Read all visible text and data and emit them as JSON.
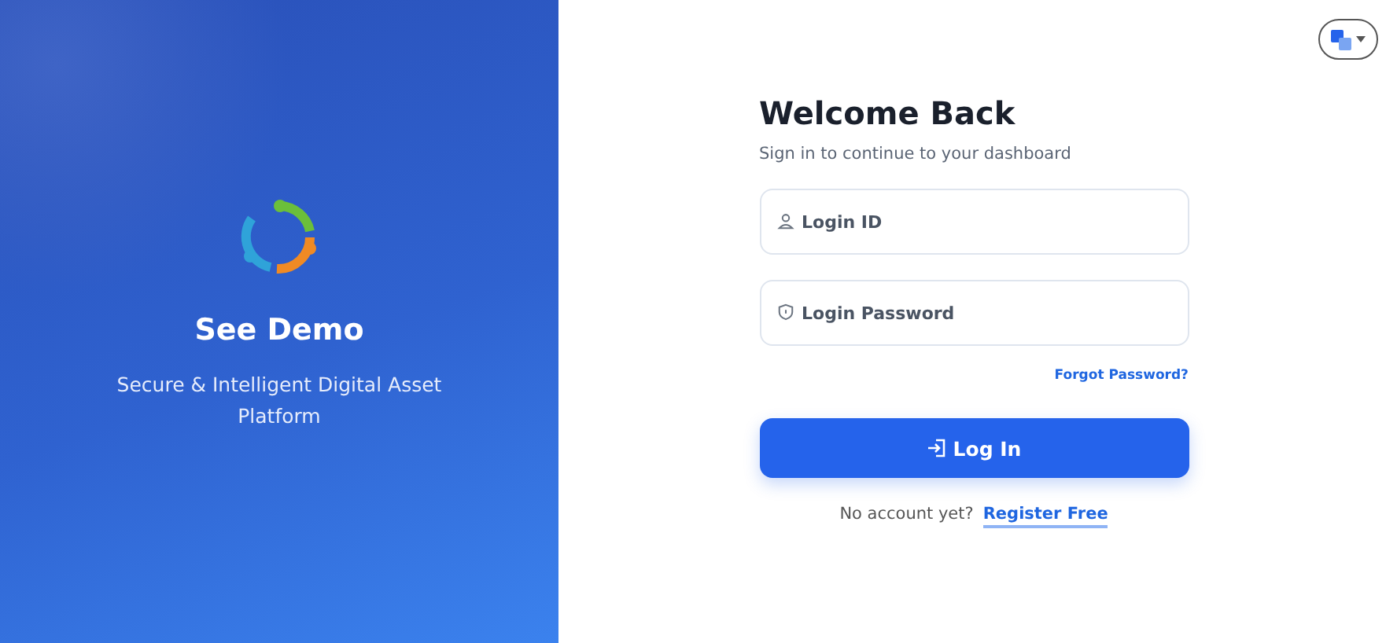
{
  "brand": {
    "name": "See Demo",
    "tagline": "Secure & Intelligent Digital Asset Platform"
  },
  "heading": "Welcome Back",
  "subheading": "Sign in to continue to your dashboard",
  "fields": [
    {
      "kind": "user",
      "placeholder": "Login ID"
    },
    {
      "kind": "password",
      "placeholder": "Login Password"
    }
  ],
  "forgot_link": "Forgot Password?",
  "login_button": "Log In",
  "register": {
    "prompt": "No account yet?",
    "link": "Register Free"
  }
}
